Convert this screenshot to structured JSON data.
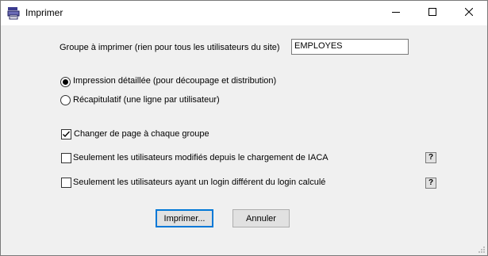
{
  "window": {
    "title": "Imprimer"
  },
  "titlebar": {
    "minimize_icon": "minimize-icon",
    "maximize_icon": "maximize-icon",
    "close_icon": "close-icon"
  },
  "group": {
    "label": "Groupe à imprimer (rien pour tous les utilisateurs du site)",
    "value": "EMPLOYES"
  },
  "mode": {
    "options": [
      {
        "label": "Impression détaillée (pour découpage et distribution)",
        "selected": true
      },
      {
        "label": "Récapitulatif (une ligne par utilisateur)",
        "selected": false
      }
    ]
  },
  "options": {
    "page_break": {
      "label": "Changer de page à chaque groupe",
      "checked": true
    },
    "modified_only": {
      "label": "Seulement les utilisateurs modifiés depuis le chargement de IACA",
      "checked": false,
      "help": "?"
    },
    "diff_login": {
      "label": "Seulement les utilisateurs ayant un login différent du login calculé",
      "checked": false,
      "help": "?"
    }
  },
  "buttons": {
    "print": "Imprimer...",
    "cancel": "Annuler"
  }
}
